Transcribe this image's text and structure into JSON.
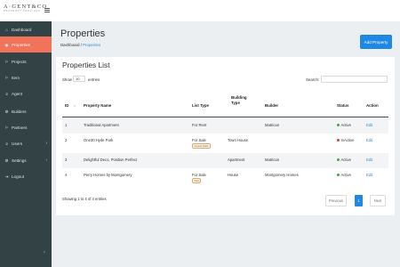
{
  "logo": {
    "brand": "A·GENT&CO",
    "tagline": "PROPERTY SERVICES"
  },
  "sidebar": {
    "items": [
      {
        "label": "Dashboard",
        "icon": "home-icon",
        "glyph": "⌂"
      },
      {
        "label": "Properties",
        "icon": "location-pin-icon",
        "glyph": "◉",
        "active": true
      },
      {
        "label": "Projects",
        "icon": "projects-icon",
        "glyph": "⚐"
      },
      {
        "label": "Item",
        "icon": "item-icon",
        "glyph": "⚐"
      },
      {
        "label": "Agent",
        "icon": "agent-icon",
        "glyph": "☺"
      },
      {
        "label": "Builders",
        "icon": "builders-icon",
        "glyph": "⚙"
      },
      {
        "label": "Partners",
        "icon": "partners-icon",
        "glyph": "⚐"
      },
      {
        "label": "Users",
        "icon": "users-icon",
        "glyph": "☺",
        "chevron": "›"
      },
      {
        "label": "Settings",
        "icon": "settings-icon",
        "glyph": "⚙",
        "chevron": "›"
      },
      {
        "label": "Logout",
        "icon": "logout-icon",
        "glyph": "⇥"
      }
    ],
    "collapse_glyph": "‹"
  },
  "header": {
    "title": "Properties",
    "breadcrumb": {
      "root": "Dashboard",
      "separator": " / ",
      "current": "Properties"
    },
    "add_button": "Add Property"
  },
  "list": {
    "title": "Properties List",
    "show_label": "Show",
    "entries_value": "10",
    "entries_label": "entries",
    "search_label": "Search:",
    "search_value": "",
    "columns": [
      "ID",
      "Property Name",
      "List Type",
      "Building Type",
      "Builder",
      "Status",
      "Action"
    ],
    "rows": [
      {
        "id": "1",
        "name": "Traditional Apartment",
        "list_type": "For Rent",
        "badge": "",
        "building_type": "",
        "builder": "Matrican",
        "status": "Active",
        "status_color": "#3aa845",
        "action": "Edit"
      },
      {
        "id": "2",
        "name": "One30 Hyde Park",
        "list_type": "For Sale",
        "badge": "Deposit Taken",
        "building_type": "Town House",
        "builder": "",
        "status": "InActive",
        "status_color": "#e53935",
        "action": "Edit"
      },
      {
        "id": "3",
        "name": "Delightful Deco, Position Perfect",
        "list_type": "",
        "badge": "",
        "building_type": "Apartment",
        "builder": "Matrican",
        "status": "Active",
        "status_color": "#3aa845",
        "action": "Edit"
      },
      {
        "id": "4",
        "name": "Perry Homes by Montgomery",
        "list_type": "For Sale",
        "badge": "Sold",
        "building_type": "House",
        "builder": "Montgomery Homes",
        "status": "Active",
        "status_color": "#3aa845",
        "action": "Edit"
      }
    ],
    "info": "Showing 1 to 4 of 4 entries",
    "pagination": {
      "previous": "Previous",
      "current": "1",
      "next": "Next"
    }
  },
  "colors": {
    "sidebar": "#334245",
    "active": "#f0735a",
    "primary": "#1f88e5",
    "link": "#2d8fd0"
  }
}
